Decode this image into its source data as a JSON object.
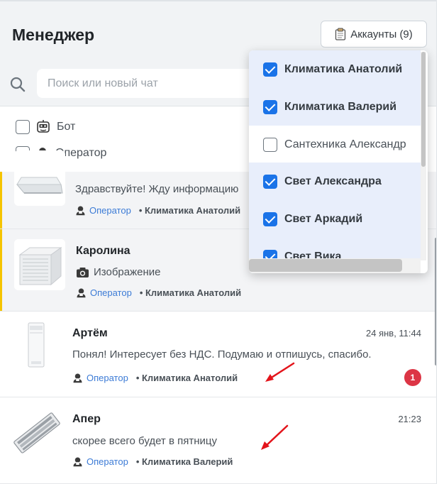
{
  "header": {
    "title": "Менеджер",
    "accounts_button": "Аккаунты (9)"
  },
  "search": {
    "placeholder": "Поиск или новый чат"
  },
  "filters": [
    {
      "label": "Бот",
      "checked": false,
      "icon": "bot-icon"
    },
    {
      "label": "Оператор",
      "checked": false,
      "icon": "operator-icon"
    }
  ],
  "accounts_dropdown": {
    "items": [
      {
        "label": "Климатика Анатолий",
        "checked": true
      },
      {
        "label": "Климатика Валерий",
        "checked": true
      },
      {
        "label": "Сантехника Александр",
        "checked": false
      },
      {
        "label": "Свет Александра",
        "checked": true
      },
      {
        "label": "Свет Аркадий",
        "checked": true
      },
      {
        "label": "Свет Вика",
        "checked": true
      }
    ]
  },
  "chats": [
    {
      "name": "",
      "message": "Здравствуйте! Жду информацию",
      "role": "Оператор",
      "account": "• Климатика Анатолий",
      "time": "",
      "unread": "",
      "thumb": "tray-image"
    },
    {
      "name": "Каролина",
      "message": "Изображение",
      "message_icon": "camera-icon",
      "role": "Оператор",
      "account": "• Климатика Анатолий",
      "time": "",
      "unread": "",
      "thumb": "humidifier-image"
    },
    {
      "name": "Артём",
      "message": "Понял! Интересует без НДС. Подумаю и отпишусь, спасибо.",
      "role": "Оператор",
      "account": "• Климатика Анатолий",
      "time": "24 янв, 11:44",
      "unread": "1",
      "thumb": "air-conditioner-image"
    },
    {
      "name": "Апер",
      "message": "скорее всего будет в пятницу",
      "role": "Оператор",
      "account": "• Климатика Валерий",
      "time": "21:23",
      "unread": "",
      "thumb": "lamp-image"
    }
  ],
  "colors": {
    "accent": "#1a73e8",
    "role_link": "#3c7bd6",
    "badge": "#dc3545",
    "active_bar": "#f5c400",
    "annotation_arrow": "#e3141b"
  }
}
